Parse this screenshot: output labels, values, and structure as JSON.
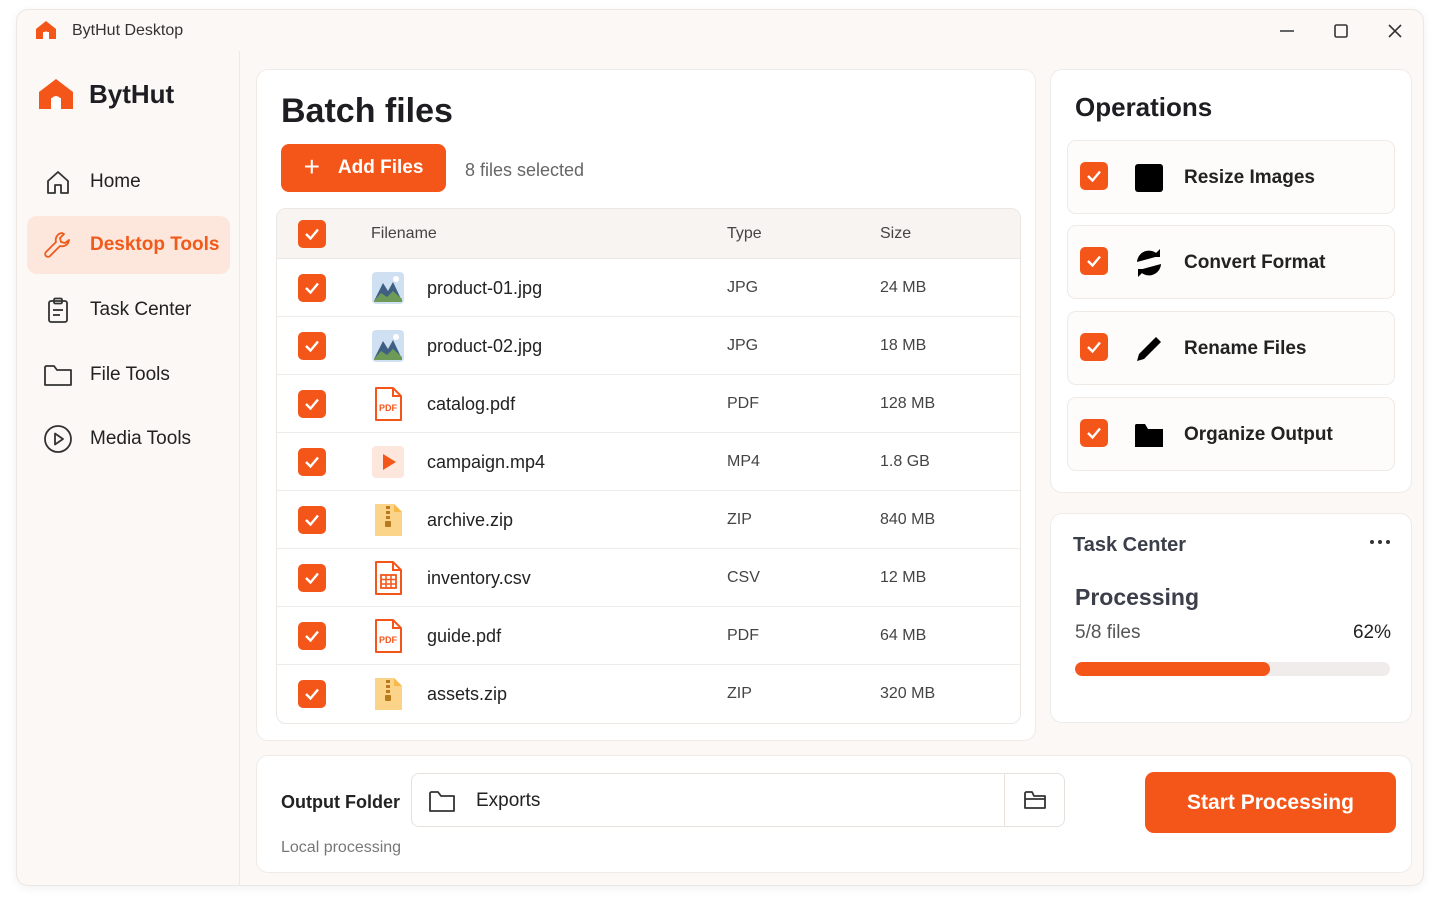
{
  "window": {
    "title": "BytHut Desktop",
    "icons": {
      "logo": "house-logo-icon",
      "minimize": "minimize-icon",
      "maximize": "maximize-icon",
      "close": "close-icon"
    }
  },
  "sidebar": {
    "brand": "BytHut",
    "items": [
      {
        "label": "Home",
        "icon": "home-icon",
        "active": false
      },
      {
        "label": "Desktop Tools",
        "icon": "wrench-icon",
        "active": true
      },
      {
        "label": "Task Center",
        "icon": "clipboard-icon",
        "active": false
      },
      {
        "label": "File Tools",
        "icon": "folder-icon",
        "active": false
      },
      {
        "label": "Media Tools",
        "icon": "play-circle-icon",
        "active": false
      }
    ]
  },
  "batch": {
    "title": "Batch files",
    "add_label": "Add Files",
    "selected_text": "8 files selected",
    "columns": {
      "filename": "Filename",
      "type": "Type",
      "size": "Size"
    },
    "files": [
      {
        "name": "product-01.jpg",
        "type": "JPG",
        "size": "24 MB",
        "kind": "image",
        "checked": true
      },
      {
        "name": "product-02.jpg",
        "type": "JPG",
        "size": "18 MB",
        "kind": "image",
        "checked": true
      },
      {
        "name": "catalog.pdf",
        "type": "PDF",
        "size": "128 MB",
        "kind": "pdf",
        "checked": true
      },
      {
        "name": "campaign.mp4",
        "type": "MP4",
        "size": "1.8 GB",
        "kind": "video",
        "checked": true
      },
      {
        "name": "archive.zip",
        "type": "ZIP",
        "size": "840 MB",
        "kind": "zip",
        "checked": true
      },
      {
        "name": "inventory.csv",
        "type": "CSV",
        "size": "12 MB",
        "kind": "csv",
        "checked": true
      },
      {
        "name": "guide.pdf",
        "type": "PDF",
        "size": "64 MB",
        "kind": "pdf",
        "checked": true
      },
      {
        "name": "assets.zip",
        "type": "ZIP",
        "size": "320 MB",
        "kind": "zip",
        "checked": true
      }
    ],
    "pdf_badge": "PDF"
  },
  "operations": {
    "title": "Operations",
    "items": [
      {
        "label": "Resize Images",
        "icon": "image-icon",
        "checked": true
      },
      {
        "label": "Convert Format",
        "icon": "refresh-icon",
        "checked": true
      },
      {
        "label": "Rename Files",
        "icon": "pencil-icon",
        "checked": true
      },
      {
        "label": "Organize Output",
        "icon": "folder-icon",
        "checked": true
      }
    ]
  },
  "task_center": {
    "title": "Task Center",
    "status": "Processing",
    "count": "5/8 files",
    "percent_label": "62%",
    "progress": 0.62
  },
  "output": {
    "label": "Output Folder",
    "value": "Exports",
    "note": "Local processing",
    "start_label": "Start Processing"
  },
  "colors": {
    "accent": "#f4561a",
    "active_bg": "#fde7dc",
    "text": "#1d1d22"
  }
}
